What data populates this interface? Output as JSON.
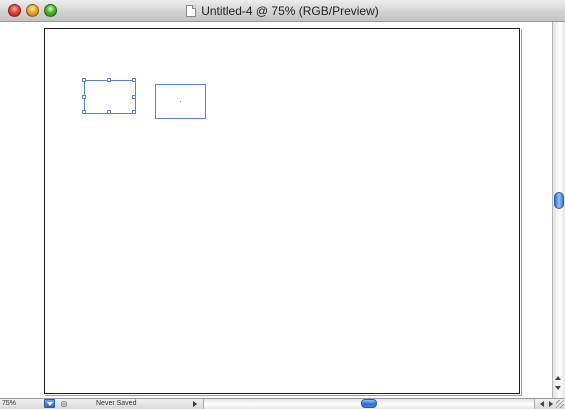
{
  "window": {
    "title": "Untitled-4 @ 75% (RGB/Preview)",
    "icon": "document-icon"
  },
  "traffic_lights": {
    "close_icon": "close-icon",
    "minimize_icon": "minimize-icon",
    "zoom_icon": "zoom-icon"
  },
  "status_bar": {
    "zoom_value": "75%",
    "status_text": "Never Saved",
    "zoom_popup_icon": "chevron-down-icon",
    "status_icon": "info-icon"
  },
  "colors": {
    "selection": "#5d7fd6",
    "scroll_thumb": "#2f6fd1",
    "close": "#e0443e",
    "minimize": "#e8a627",
    "zoom": "#4eb42e"
  }
}
